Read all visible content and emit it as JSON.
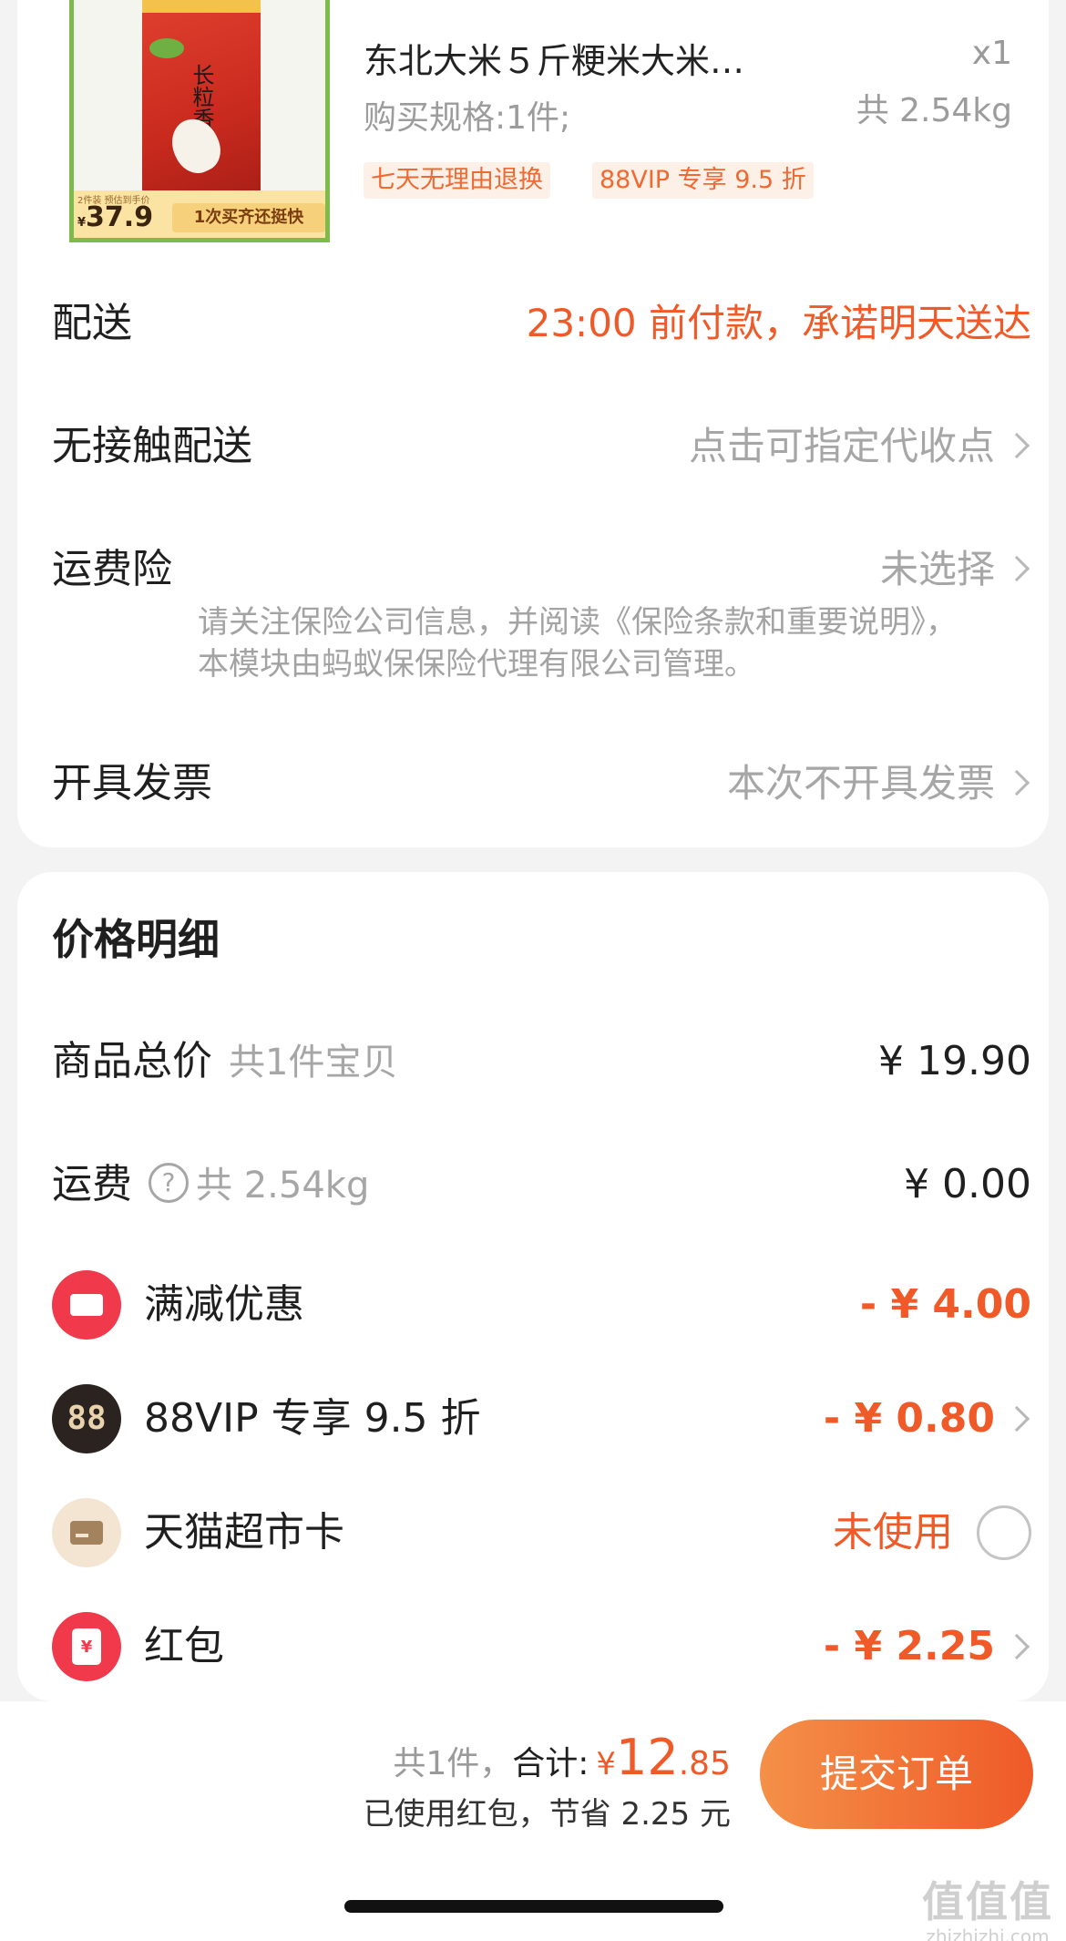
{
  "product": {
    "title": "东北大米５斤粳米大米…",
    "quantity": "x1",
    "spec": "购买规格:1件;",
    "weight": "共 2.54kg",
    "tags": [
      "七天无理由退换",
      "88VIP 专享 9.5 折"
    ],
    "image": {
      "bag_text": "长粒香米",
      "strip_note": "2件装 预估到手价",
      "strip_price_symbol": "¥",
      "strip_price": "37.9",
      "strip_slogan": "1次买齐还挺快"
    }
  },
  "order_options": [
    {
      "label": "配送",
      "value": "23:00 前付款，承诺明天送达",
      "style": "orange",
      "arrow": false
    },
    {
      "label": "无接触配送",
      "value": "点击可指定代收点",
      "style": "grey",
      "arrow": true
    },
    {
      "label": "运费险",
      "value": "未选择",
      "style": "grey",
      "arrow": true
    },
    {
      "label": "开具发票",
      "value": "本次不开具发票",
      "style": "grey",
      "arrow": true
    }
  ],
  "insurance_note": "请关注保险公司信息，并阅读《保险条款和重要说明》，本模块由蚂蚁保保险代理有限公司管理。",
  "price_detail": {
    "title": "价格明细",
    "rows": [
      {
        "label": "商品总价",
        "note": "共1件宝贝",
        "value": "¥ 19.90"
      },
      {
        "label": "运费",
        "help_icon": "question-circle-icon",
        "help_glyph": "?",
        "note": "共 2.54kg",
        "value": "¥ 0.00"
      },
      {
        "label": "满减优惠",
        "icon": "coupon-icon",
        "value": "- ¥ 4.00"
      },
      {
        "label": "88VIP 专享 9.5 折",
        "icon": "88vip-icon",
        "icon_text": "88",
        "value": "- ¥ 0.80"
      },
      {
        "label": "天猫超市卡",
        "icon": "card-icon",
        "value": "未使用"
      },
      {
        "label": "红包",
        "icon": "red-packet-icon",
        "icon_text": "¥",
        "value": "- ¥ 2.25"
      }
    ]
  },
  "bottom_bar": {
    "count": "共1件，",
    "total_label": "合计:",
    "currency": "¥",
    "total_int": "12",
    "total_dec": ".85",
    "saved": "已使用红包，节省 2.25 元",
    "submit_label": "提交订单"
  },
  "watermark": {
    "logo": "值值值",
    "url": "zhizhizhi.com"
  },
  "colors": {
    "accent": "#ef5a28",
    "muted": "#a6a6a6",
    "card_bg": "#ffffff",
    "page_bg": "#f3f3f3"
  }
}
